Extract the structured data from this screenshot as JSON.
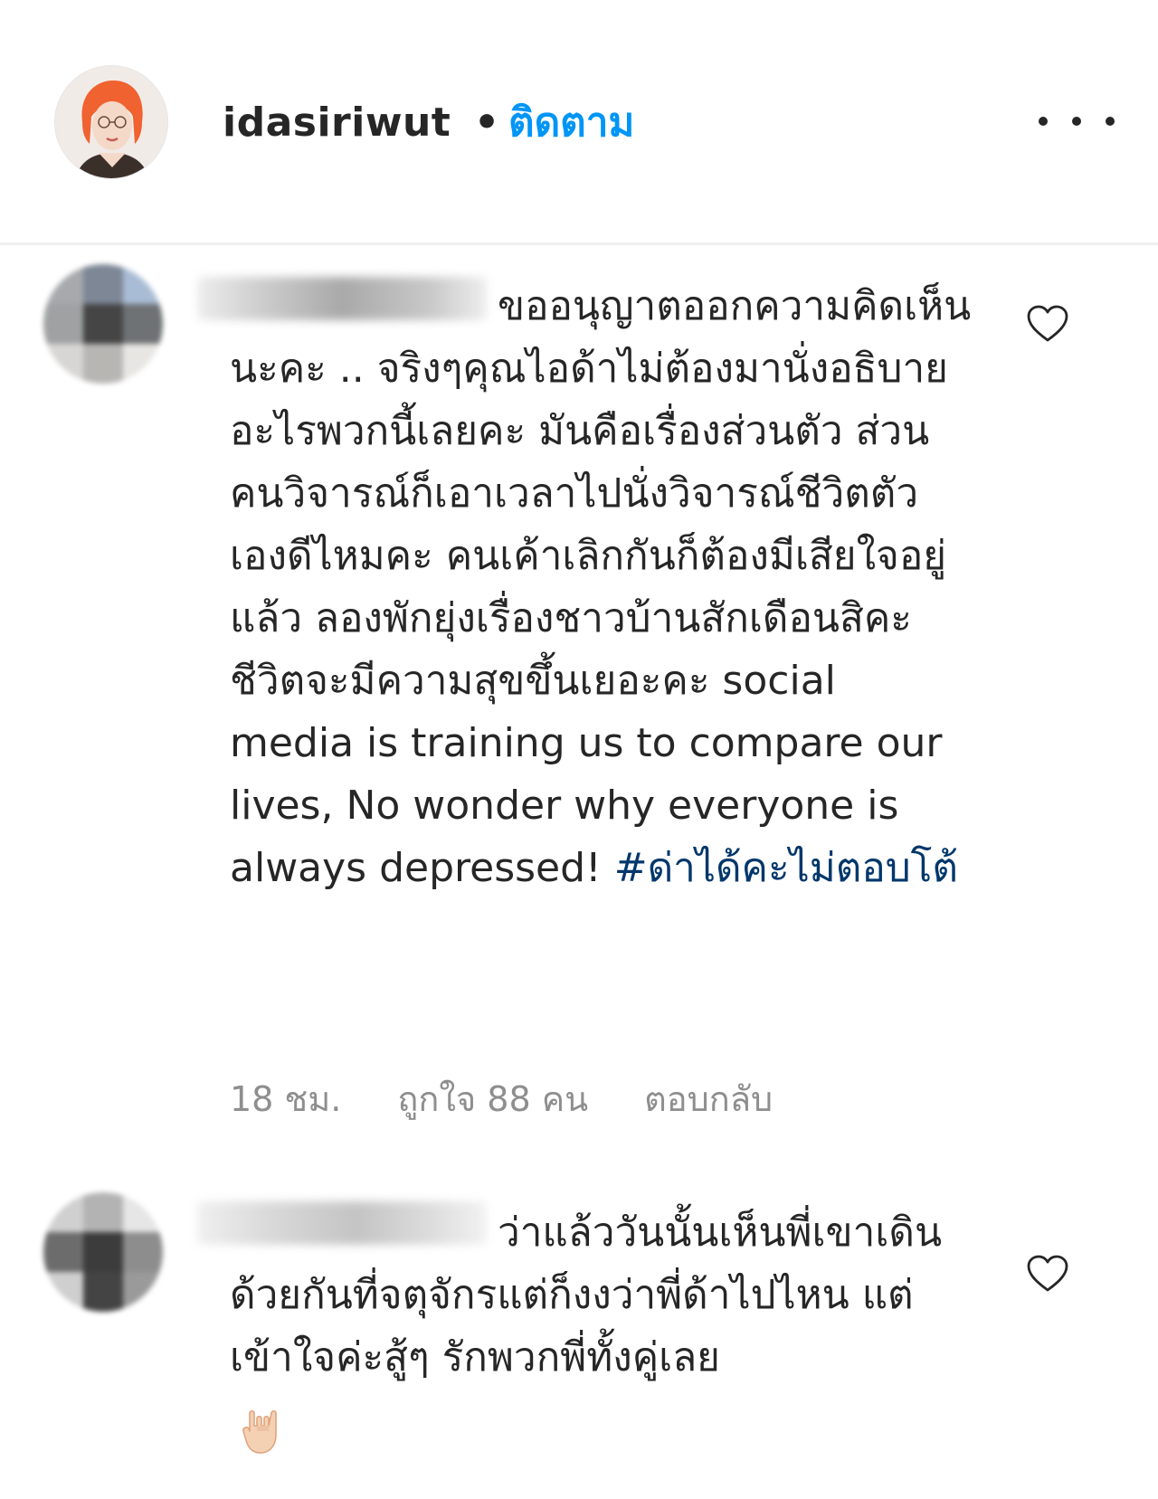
{
  "header": {
    "username": "idasiriwut",
    "separator": "•",
    "follow_label": "ติดตาม",
    "more_icon": "more-horizontal-icon"
  },
  "comments": [
    {
      "username_redacted": true,
      "text": "ขออนุญาตออกความคิดเห็นนะคะ .. จริงๆคุณไอด้าไม่ต้องมานั่งอธิบายอะไรพวกนี้เลยคะ มันคือเรื่องส่วนตัว ส่วนคนวิจารณ์ก็เอาเวลาไปนั่งวิจารณ์ชีวิตตัวเองดีไหมคะ คนเค้าเลิกกันก็ต้องมีเสียใจอยู่แล้ว ลองพักยุ่งเรื่องชาวบ้านสักเดือนสิคะ ชีวิตจะมีความสุขขึ้นเยอะคะ social media is training us to compare our lives, No wonder why everyone is always depressed!",
      "hashtag": "#ด่าได้คะไม่ตอบโต้",
      "time": "18 ชม.",
      "likes": "ถูกใจ 88 คน",
      "reply_label": "ตอบกลับ",
      "like_icon": "heart-outline-icon"
    },
    {
      "username_redacted": true,
      "text": "ว่าแล้ววันนั้นเห็นพี่เขาเดินด้วยกันที่จตุจักรแต่ก็งงว่าพี่ด้าไปไหน แต่เข้าใจค่ะสู้ๆ รักพวกพี่ทั้งคู่เลย",
      "emoji_icon": "rock-on-hand-emoji-icon",
      "like_icon": "heart-outline-icon"
    }
  ],
  "colors": {
    "follow_blue": "#0095f6",
    "hashtag_blue": "#00376b",
    "meta_gray": "#8e8e8e",
    "text": "#262626"
  }
}
